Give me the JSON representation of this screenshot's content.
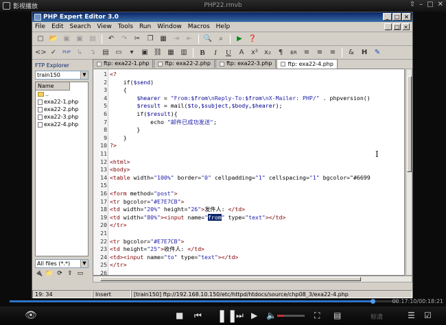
{
  "player": {
    "logo_text": "影视播放",
    "file_name": "PHP22.rmvb",
    "time": "00:17:10/00:18:21",
    "progress": 0.935,
    "quality_label": "标清"
  },
  "editor": {
    "title": "PHP Expert Editor 3.0",
    "menu": [
      "File",
      "Edit",
      "Search",
      "View",
      "Tools",
      "Run",
      "Window",
      "Macros",
      "Help"
    ],
    "ftp": {
      "title": "FTP Explorer",
      "server": "train150",
      "column": "Name",
      "items": [
        "..",
        "exa22-1.php",
        "exa22-2.php",
        "exa22-3.php",
        "exa22-4.php"
      ],
      "filter": "All files (*.*)"
    },
    "tabs": [
      "ftp: exa22-1.php",
      "ftp: exa22-2.php",
      "ftp: exa22-3.php",
      "ftp: exa22-4.php"
    ],
    "active_tab": 3,
    "code_lines": [
      "<?",
      "    if($send)",
      "    {",
      "        $hearer = \"From:$from\\nReply-To:$from\\nX-Mailer: PHP/\" . phpversion()",
      "        $result = mail($to,$subject,$body,$hearer);",
      "        if($result){",
      "            echo \"邮件已成功发送\";",
      "        }",
      "    }",
      "?>",
      "",
      "<html>",
      "<body>",
      "<table width=\"100%\" border=\"0\" cellpadding=\"1\" cellspacing=\"1\" bgcolor=\"#6699",
      "",
      "<form method=\"post\">",
      "<tr bgcolor=\"#E7E7CB\">",
      "<td width=\"20%\" height=\"26\">发件人: </td>",
      "<td width=\"80%\"><input name=\"from\" type=\"text\"></td>",
      "</tr>",
      "",
      "<tr bgcolor=\"#E7E7CB\">",
      "<td height=\"25\">收件人: </td>",
      "<td><input name=\"to\" type=\"text\"></td>",
      "</tr>",
      ""
    ],
    "status": {
      "position": "19: 34",
      "mode": "Insert",
      "path": "[train150] ftp://192.168.10.150/etc/httpd/htdocs/source/chp08_3/exa22-4.php"
    }
  }
}
